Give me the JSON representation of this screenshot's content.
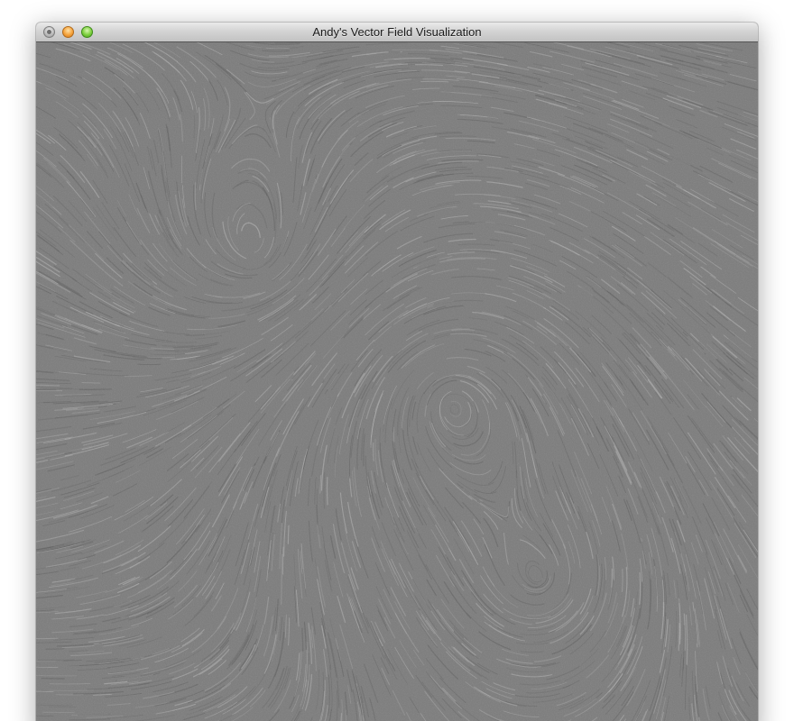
{
  "window": {
    "title": "Andy's Vector Field Visualization",
    "controls": [
      {
        "name": "close-button",
        "icon": "close-icon",
        "color": "#a9a9a9"
      },
      {
        "name": "minimize-button",
        "icon": "minimize-icon",
        "color": "#f5a33c"
      },
      {
        "name": "zoom-button",
        "icon": "zoom-icon",
        "color": "#7ccf3d"
      }
    ]
  },
  "visualization": {
    "description_kind": "line-integral-convolution",
    "background_color": "#7c7c7c",
    "streak_light": "#b4b4b4",
    "streak_dark": "#5e5e5e"
  }
}
